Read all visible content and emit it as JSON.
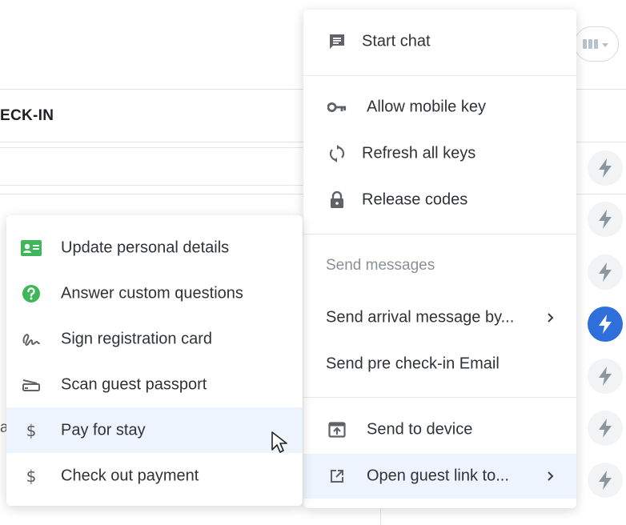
{
  "table": {
    "column_title": "ECK-IN",
    "truncated_cell": "a"
  },
  "colors": {
    "accent": "#2f6fdc",
    "highlight": "#edf4fd",
    "icon_gray": "#5f6368",
    "green": "#3fb65a"
  },
  "dropdown": {
    "start_chat": "Start chat",
    "allow_mobile_key": "Allow mobile key",
    "refresh_all_keys": "Refresh all keys",
    "release_codes": "Release codes",
    "section_send_messages": "Send messages",
    "send_arrival_message": "Send arrival message by...",
    "send_pre_checkin_email": "Send pre check-in Email",
    "send_to_device": "Send to device",
    "open_guest_link": "Open guest link to..."
  },
  "submenu": {
    "items": [
      {
        "label": "Update personal details",
        "icon": "id-card-icon"
      },
      {
        "label": "Answer custom questions",
        "icon": "question-circle-icon"
      },
      {
        "label": "Sign registration card",
        "icon": "signature-icon"
      },
      {
        "label": "Scan guest passport",
        "icon": "scanner-icon"
      },
      {
        "label": "Pay for stay",
        "icon": "dollar-icon"
      },
      {
        "label": "Check out payment",
        "icon": "dollar-icon"
      }
    ]
  }
}
